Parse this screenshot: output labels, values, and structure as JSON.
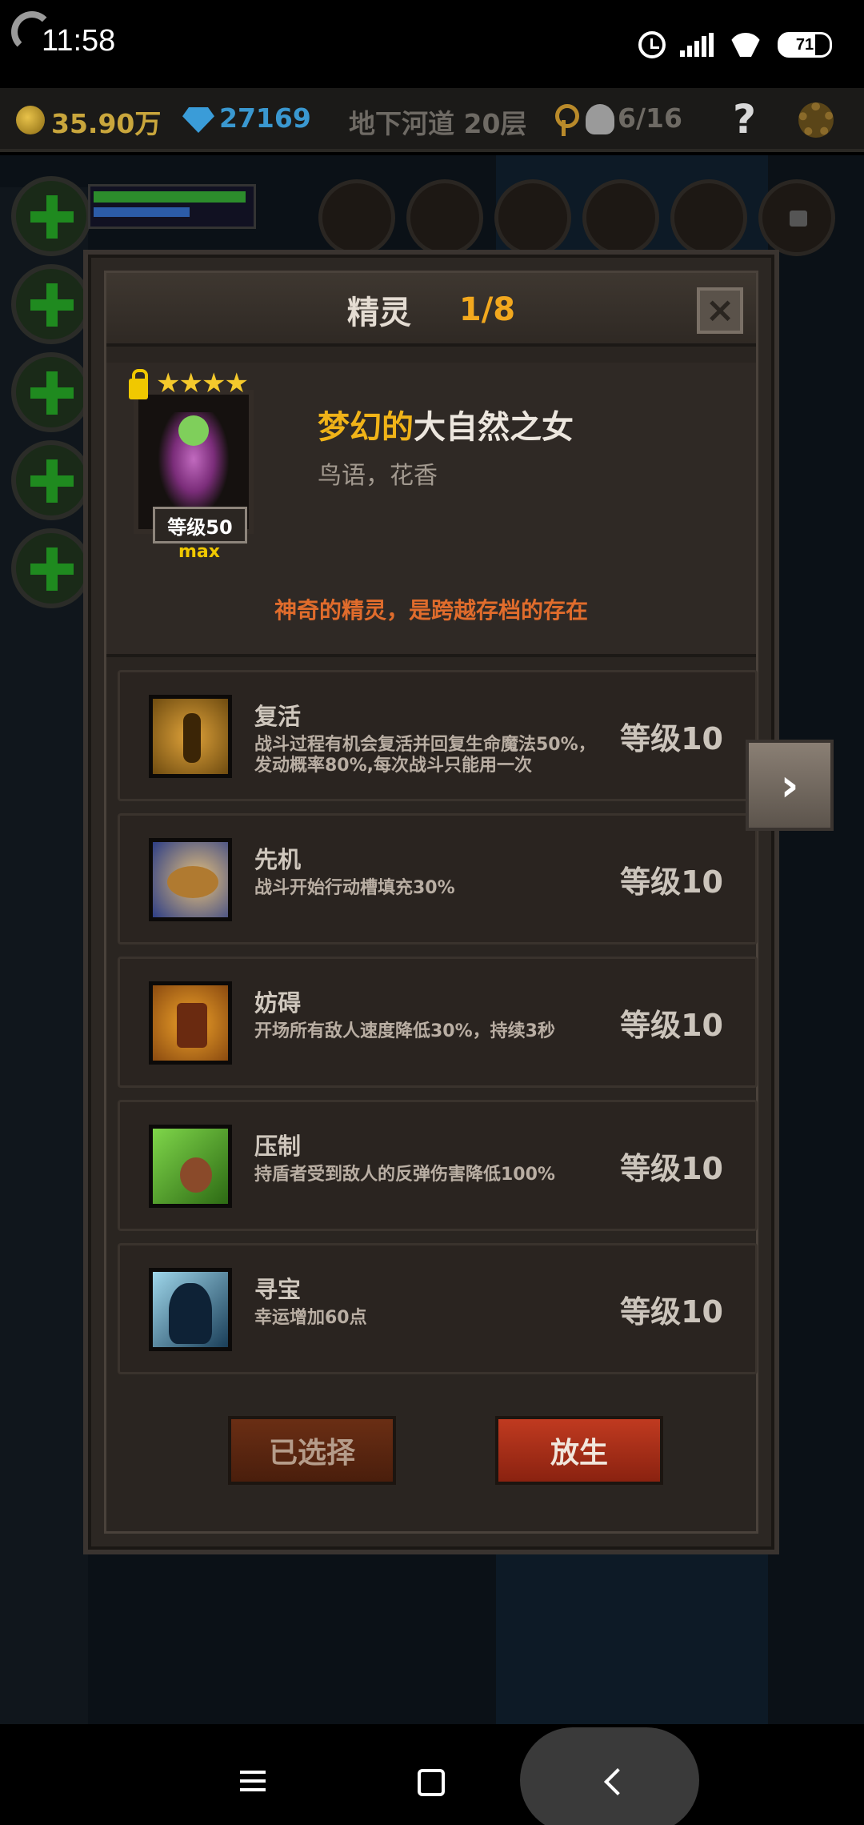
{
  "status_bar": {
    "time": "11:58",
    "battery": "71"
  },
  "top_bar": {
    "gold": "35.90万",
    "gems": "27169",
    "location": "地下河道 20层",
    "kills": "6/16",
    "help": "?"
  },
  "dialog": {
    "title": "精灵",
    "page": "1/8",
    "close_label": "×",
    "spirit": {
      "stars": "★★★★",
      "level_badge": "等级50",
      "max_label": "max",
      "name_prefix": "梦幻的",
      "name": "大自然之女",
      "subtitle": "鸟语，花香",
      "description": "神奇的精灵，是跨越存档的存在"
    },
    "skills": [
      {
        "name": "复活",
        "desc": "战斗过程有机会复活并回复生命魔法50%，发动概率80%,每次战斗只能用一次",
        "level": "等级10",
        "icon": "revive-icon"
      },
      {
        "name": "先机",
        "desc": "战斗开始行动槽填充30%",
        "level": "等级10",
        "icon": "leopard-icon"
      },
      {
        "name": "妨碍",
        "desc": "开场所有敌人速度降低30%，持续3秒",
        "level": "等级10",
        "icon": "chained-boot-icon"
      },
      {
        "name": "压制",
        "desc": "持盾者受到敌人的反弹伤害降低100%",
        "level": "等级10",
        "icon": "claw-icon"
      },
      {
        "name": "寻宝",
        "desc": "幸运增加60点",
        "level": "等级10",
        "icon": "silhouette-stars-icon"
      }
    ],
    "buttons": {
      "selected": "已选择",
      "release": "放生"
    }
  },
  "colors": {
    "accent_orange": "#f2a81e",
    "name_gold": "#f0b318",
    "desc_orange": "#e06c2c",
    "release_red": "#c03a20"
  }
}
